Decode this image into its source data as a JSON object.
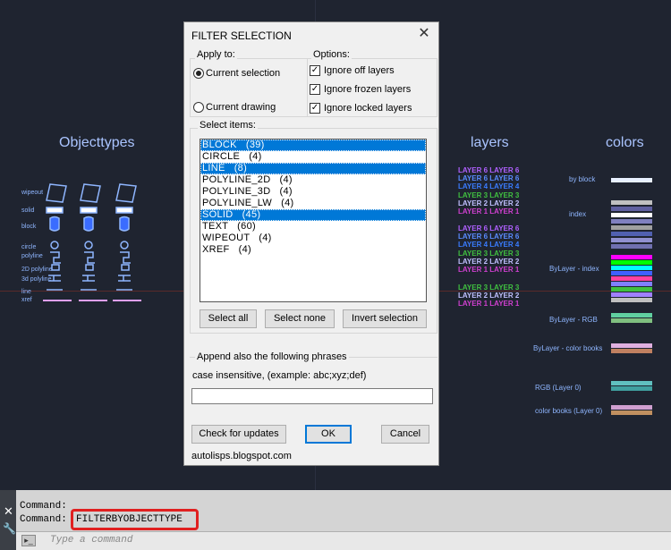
{
  "canvas": {
    "titles": {
      "objecttypes": "Objecttypes",
      "layers": "layers",
      "colors": "colors"
    },
    "object_labels": [
      "wipeout",
      "solid",
      "block",
      "circle",
      "polyline",
      "2D polyline",
      "3d polyline",
      "line",
      "xref"
    ],
    "layer_groups": [
      [
        "LAYER 6   LAYER 6",
        "LAYER 6   LAYER 6",
        "LAYER 4   LAYER 4",
        "LAYER 3   LAYER 3",
        "LAYER 2   LAYER 2",
        "LAYER 1   LAYER 1"
      ],
      [
        "LAYER 6   LAYER 6",
        "LAYER 6   LAYER 6",
        "LAYER 4   LAYER 4",
        "LAYER 3   LAYER 3",
        "LAYER 2   LAYER 2",
        "LAYER 1   LAYER 1"
      ],
      [
        "LAYER 3   LAYER 3",
        "LAYER 2   LAYER 2",
        "LAYER 1   LAYER 1"
      ]
    ],
    "layer_colors": [
      "#b060ff",
      "#5a8cff",
      "#3a7cff",
      "#40c040",
      "#c0c0ff",
      "#d040d0"
    ],
    "color_labels": [
      "by block",
      "index",
      "ByLayer - index",
      "ByLayer - RGB",
      "ByLayer - color books",
      "RGB (Layer 0)",
      "color books (Layer 0)"
    ]
  },
  "dialog": {
    "title": "FILTER SELECTION",
    "apply_to": {
      "legend": "Apply to:",
      "options": [
        {
          "label": "Current selection",
          "selected": true
        },
        {
          "label": "Current drawing",
          "selected": false
        }
      ]
    },
    "options": {
      "legend": "Options:",
      "items": [
        {
          "label": "Ignore off layers",
          "checked": true
        },
        {
          "label": "Ignore frozen layers",
          "checked": true
        },
        {
          "label": "Ignore locked layers",
          "checked": true
        }
      ]
    },
    "select_items": {
      "legend": "Select items:",
      "items": [
        {
          "label": "BLOCK   (39)",
          "selected": true
        },
        {
          "label": "CIRCLE   (4)",
          "selected": false
        },
        {
          "label": "LINE   (8)",
          "selected": true
        },
        {
          "label": "POLYLINE_2D   (4)",
          "selected": false
        },
        {
          "label": "POLYLINE_3D   (4)",
          "selected": false
        },
        {
          "label": "POLYLINE_LW   (4)",
          "selected": false
        },
        {
          "label": "SOLID   (45)",
          "selected": true
        },
        {
          "label": "TEXT   (60)",
          "selected": false
        },
        {
          "label": "WIPEOUT   (4)",
          "selected": false
        },
        {
          "label": "XREF   (4)",
          "selected": false
        }
      ],
      "buttons": {
        "select_all": "Select all",
        "select_none": "Select none",
        "invert": "Invert selection"
      }
    },
    "append": {
      "legend": "Append also the following phrases",
      "hint": "case insensitive, (example:  abc;xyz;def)",
      "value": ""
    },
    "buttons": {
      "check_updates": "Check for updates",
      "ok": "OK",
      "cancel": "Cancel"
    },
    "footer": "autolisps.blogspot.com"
  },
  "command": {
    "line1": "Command:",
    "line2_prefix": "Command:",
    "line2_value": "FILTERBYOBJECTTYPE",
    "placeholder": "Type a command"
  }
}
